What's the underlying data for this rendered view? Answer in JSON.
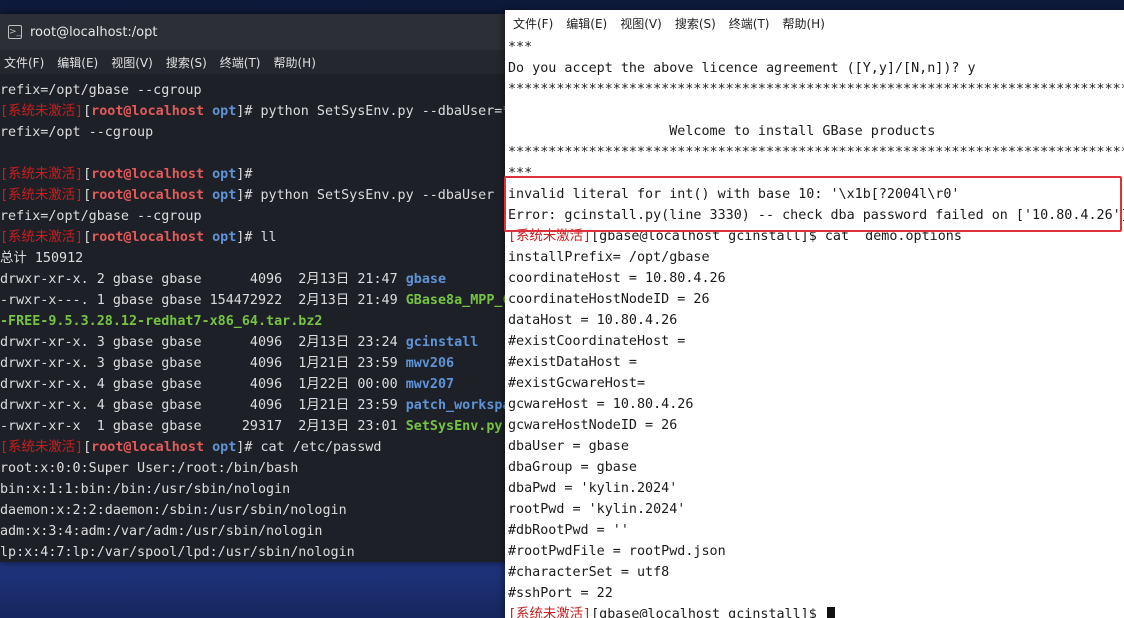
{
  "left_window": {
    "title": "root@localhost:/opt",
    "menu": [
      "文件(F)",
      "编辑(E)",
      "视图(V)",
      "搜索(S)",
      "终端(T)",
      "帮助(H)"
    ],
    "lines": [
      [
        {
          "t": "refix=/opt/gbase --cgroup",
          "c": ""
        }
      ],
      [
        {
          "t": "[系统未激活]",
          "c": "red"
        },
        {
          "t": "[",
          "c": ""
        },
        {
          "t": "root@localhost",
          "c": "user"
        },
        {
          "t": " ",
          "c": ""
        },
        {
          "t": "opt",
          "c": "dir"
        },
        {
          "t": "]# python SetSysEnv.py --dbaUser=",
          "c": ""
        },
        {
          "t": "***",
          "c": ""
        }
      ],
      [
        {
          "t": "refix=/opt --cgroup",
          "c": ""
        }
      ],
      [
        {
          "t": "",
          "c": ""
        }
      ],
      [
        {
          "t": "[系统未激活]",
          "c": "red"
        },
        {
          "t": "[",
          "c": ""
        },
        {
          "t": "root@localhost",
          "c": "user"
        },
        {
          "t": " ",
          "c": ""
        },
        {
          "t": "opt",
          "c": "dir"
        },
        {
          "t": "]#",
          "c": ""
        }
      ],
      [
        {
          "t": "[系统未激活]",
          "c": "red"
        },
        {
          "t": "[",
          "c": ""
        },
        {
          "t": "root@localhost",
          "c": "user"
        },
        {
          "t": " ",
          "c": ""
        },
        {
          "t": "opt",
          "c": "dir"
        },
        {
          "t": "]# python SetSysEnv.py --dbaUser",
          "c": ""
        }
      ],
      [
        {
          "t": "refix=/opt/gbase --cgroup",
          "c": ""
        }
      ],
      [
        {
          "t": "[系统未激活]",
          "c": "red"
        },
        {
          "t": "[",
          "c": ""
        },
        {
          "t": "root@localhost",
          "c": "user"
        },
        {
          "t": " ",
          "c": ""
        },
        {
          "t": "opt",
          "c": "dir"
        },
        {
          "t": "]# ll",
          "c": ""
        }
      ],
      [
        {
          "t": "总计 150912",
          "c": ""
        }
      ],
      [
        {
          "t": "drwxr-xr-x. 2 gbase gbase      4096  2月13日 21:47 ",
          "c": ""
        },
        {
          "t": "gbase",
          "c": "dir"
        }
      ],
      [
        {
          "t": "-rwxr-x---. 1 gbase gbase 154472922  2月13日 21:49 ",
          "c": ""
        },
        {
          "t": "GBase8a_MPP_C",
          "c": "exe"
        }
      ],
      [
        {
          "t": "-FREE-9.5.3.28.12-redhat7-x86_64.tar.bz2",
          "c": "exe"
        }
      ],
      [
        {
          "t": "drwxr-xr-x. 3 gbase gbase      4096  2月13日 23:24 ",
          "c": ""
        },
        {
          "t": "gcinstall",
          "c": "dir"
        }
      ],
      [
        {
          "t": "drwxr-xr-x. 3 gbase gbase      4096  1月21日 23:59 ",
          "c": ""
        },
        {
          "t": "mwv206",
          "c": "dir"
        }
      ],
      [
        {
          "t": "drwxr-xr-x. 4 gbase gbase      4096  1月22日 00:00 ",
          "c": ""
        },
        {
          "t": "mwv207",
          "c": "dir"
        }
      ],
      [
        {
          "t": "drwxr-xr-x. 4 gbase gbase      4096  1月21日 23:59 ",
          "c": ""
        },
        {
          "t": "patch_workspa",
          "c": "dir"
        }
      ],
      [
        {
          "t": "-rwxr-xr-x  1 gbase gbase     29317  2月13日 23:01 ",
          "c": ""
        },
        {
          "t": "SetSysEnv.py",
          "c": "exe"
        }
      ],
      [
        {
          "t": "[系统未激活]",
          "c": "red"
        },
        {
          "t": "[",
          "c": ""
        },
        {
          "t": "root@localhost",
          "c": "user"
        },
        {
          "t": " ",
          "c": ""
        },
        {
          "t": "opt",
          "c": "dir"
        },
        {
          "t": "]# cat /etc/passwd",
          "c": ""
        }
      ],
      [
        {
          "t": "root:x:0:0:Super User:/root:/bin/bash",
          "c": ""
        }
      ],
      [
        {
          "t": "bin:x:1:1:bin:/bin:/usr/sbin/nologin",
          "c": ""
        }
      ],
      [
        {
          "t": "daemon:x:2:2:daemon:/sbin:/usr/sbin/nologin",
          "c": ""
        }
      ],
      [
        {
          "t": "adm:x:3:4:adm:/var/adm:/usr/sbin/nologin",
          "c": ""
        }
      ],
      [
        {
          "t": "lp:x:4:7:lp:/var/spool/lpd:/usr/sbin/nologin",
          "c": ""
        }
      ]
    ]
  },
  "right_window": {
    "menu": [
      "文件(F)",
      "编辑(E)",
      "视图(V)",
      "搜索(S)",
      "终端(T)",
      "帮助(H)"
    ],
    "lines": [
      [
        {
          "t": "***",
          "c": ""
        }
      ],
      [
        {
          "t": "Do you accept the above licence agreement ([Y,y]/[N,n])? y",
          "c": ""
        }
      ],
      [
        {
          "t": "***************************************************************************************",
          "c": ""
        }
      ],
      [
        {
          "t": "",
          "c": ""
        }
      ],
      [
        {
          "t": "                    Welcome to install GBase products",
          "c": ""
        }
      ],
      [
        {
          "t": "***************************************************************************************",
          "c": ""
        }
      ],
      [
        {
          "t": "***",
          "c": ""
        }
      ],
      [
        {
          "t": "invalid literal for int() with base 10: '\\x1b[?2004l\\r0'",
          "c": ""
        }
      ],
      [
        {
          "t": "Error: gcinstall.py(line 3330) -- check dba password failed on ['10.80.4.26']",
          "c": ""
        }
      ],
      [
        {
          "t": "[系统未激活]",
          "c": "red"
        },
        {
          "t": "[gbase@localhost gcinstall]$ cat  demo.options",
          "c": ""
        }
      ],
      [
        {
          "t": "installPrefix= /opt/gbase",
          "c": ""
        }
      ],
      [
        {
          "t": "coordinateHost = 10.80.4.26",
          "c": ""
        }
      ],
      [
        {
          "t": "coordinateHostNodeID = 26",
          "c": ""
        }
      ],
      [
        {
          "t": "dataHost = 10.80.4.26",
          "c": ""
        }
      ],
      [
        {
          "t": "#existCoordinateHost =",
          "c": ""
        }
      ],
      [
        {
          "t": "#existDataHost =",
          "c": ""
        }
      ],
      [
        {
          "t": "#existGcwareHost=",
          "c": ""
        }
      ],
      [
        {
          "t": "gcwareHost = 10.80.4.26",
          "c": ""
        }
      ],
      [
        {
          "t": "gcwareHostNodeID = 26",
          "c": ""
        }
      ],
      [
        {
          "t": "dbaUser = gbase",
          "c": ""
        }
      ],
      [
        {
          "t": "dbaGroup = gbase",
          "c": ""
        }
      ],
      [
        {
          "t": "dbaPwd = 'kylin.2024'",
          "c": ""
        }
      ],
      [
        {
          "t": "rootPwd = 'kylin.2024'",
          "c": ""
        }
      ],
      [
        {
          "t": "#dbRootPwd = ''",
          "c": ""
        }
      ],
      [
        {
          "t": "#rootPwdFile = rootPwd.json",
          "c": ""
        }
      ],
      [
        {
          "t": "#characterSet = utf8",
          "c": ""
        }
      ],
      [
        {
          "t": "#sshPort = 22",
          "c": ""
        }
      ],
      [
        {
          "t": "[系统未激活]",
          "c": "red"
        },
        {
          "t": "[gbase@localhost gcinstall]$ ",
          "c": ""
        }
      ]
    ]
  }
}
